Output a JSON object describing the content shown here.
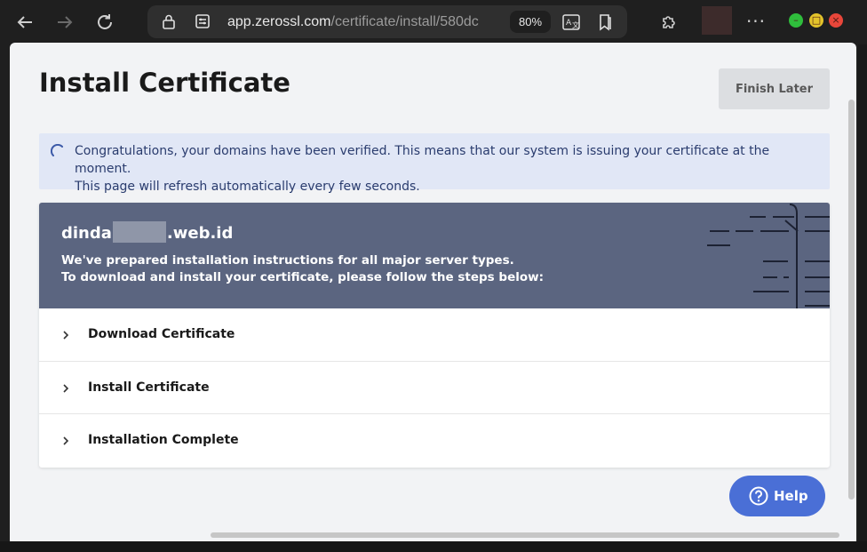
{
  "browser": {
    "url_host": "app.zerossl.com",
    "url_path": "/certificate/install/580dc",
    "zoom": "80%",
    "icons": {
      "back": "arrow-left-icon",
      "forward": "arrow-right-icon",
      "reload": "reload-icon",
      "lock": "lock-icon",
      "site_info": "site-info-icon",
      "translate": "translate-icon",
      "favorites": "favorites-icon",
      "extensions": "puzzle-icon",
      "more": "more-icon"
    },
    "colors": {
      "minimize": "#2fbd3c",
      "maximize": "#e4c42b",
      "close": "#e8463a"
    }
  },
  "page": {
    "title": "Install Certificate",
    "finish_later": "Finish Later",
    "notice": {
      "line1": "Congratulations, your domains have been verified. This means that our system is issuing your certificate at the moment.",
      "line2": "This page will refresh automatically every few seconds."
    },
    "certificate": {
      "domain_prefix": "dinda",
      "domain_suffix": ".web.id",
      "desc_line1": "We've prepared installation instructions for all major server types.",
      "desc_line2": "To download and install your certificate, please follow the steps below:"
    },
    "steps": [
      {
        "label": "Download Certificate"
      },
      {
        "label": "Install Certificate"
      },
      {
        "label": "Installation Complete"
      }
    ],
    "help": "Help",
    "colors": {
      "accent": "#4a6fd6",
      "header": "#5b6580",
      "notice_bg": "#e1e7f6"
    }
  }
}
